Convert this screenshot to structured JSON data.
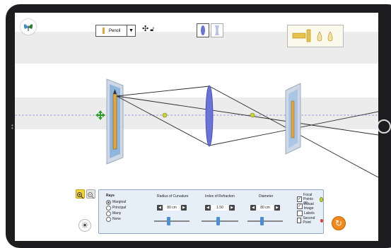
{
  "toolbar": {
    "object_select_value": "Pencil",
    "move_icon": "move-arrows-icon",
    "lock_icon": "lock-icon",
    "lens_convex_icon": "convex-lens-icon",
    "lens_concave_icon": "concave-lens-icon",
    "screen_icons": [
      "ruler-icon",
      "flame-icon",
      "flame-icon"
    ]
  },
  "controls": {
    "rays": {
      "title": "Rays",
      "options": [
        "Marginal",
        "Principal",
        "Many",
        "None"
      ],
      "selected": "Marginal"
    },
    "radius": {
      "title": "Radius of Curvature",
      "value": "80 cm",
      "level": 0.4
    },
    "index": {
      "title": "Index of Refraction",
      "value": "1.50",
      "level": 0.45
    },
    "diameter": {
      "title": "Diameter",
      "value": "80 cm",
      "level": 0.4
    },
    "checks": [
      {
        "label": "Focal Points (F)",
        "checked": true
      },
      {
        "label": "Virtual Image",
        "checked": true
      },
      {
        "label": "Labels",
        "checked": false
      },
      {
        "label": "Second Point",
        "checked": false
      }
    ]
  },
  "colors": {
    "lens": "#6a74d8",
    "axis": "#8a7bd6",
    "focal_point": "#c8d23a",
    "move_handle": "#2aa02a",
    "panel_bg": "#e6eef7",
    "panel_border": "#8fa9c5",
    "reset": "#f08a1a"
  }
}
